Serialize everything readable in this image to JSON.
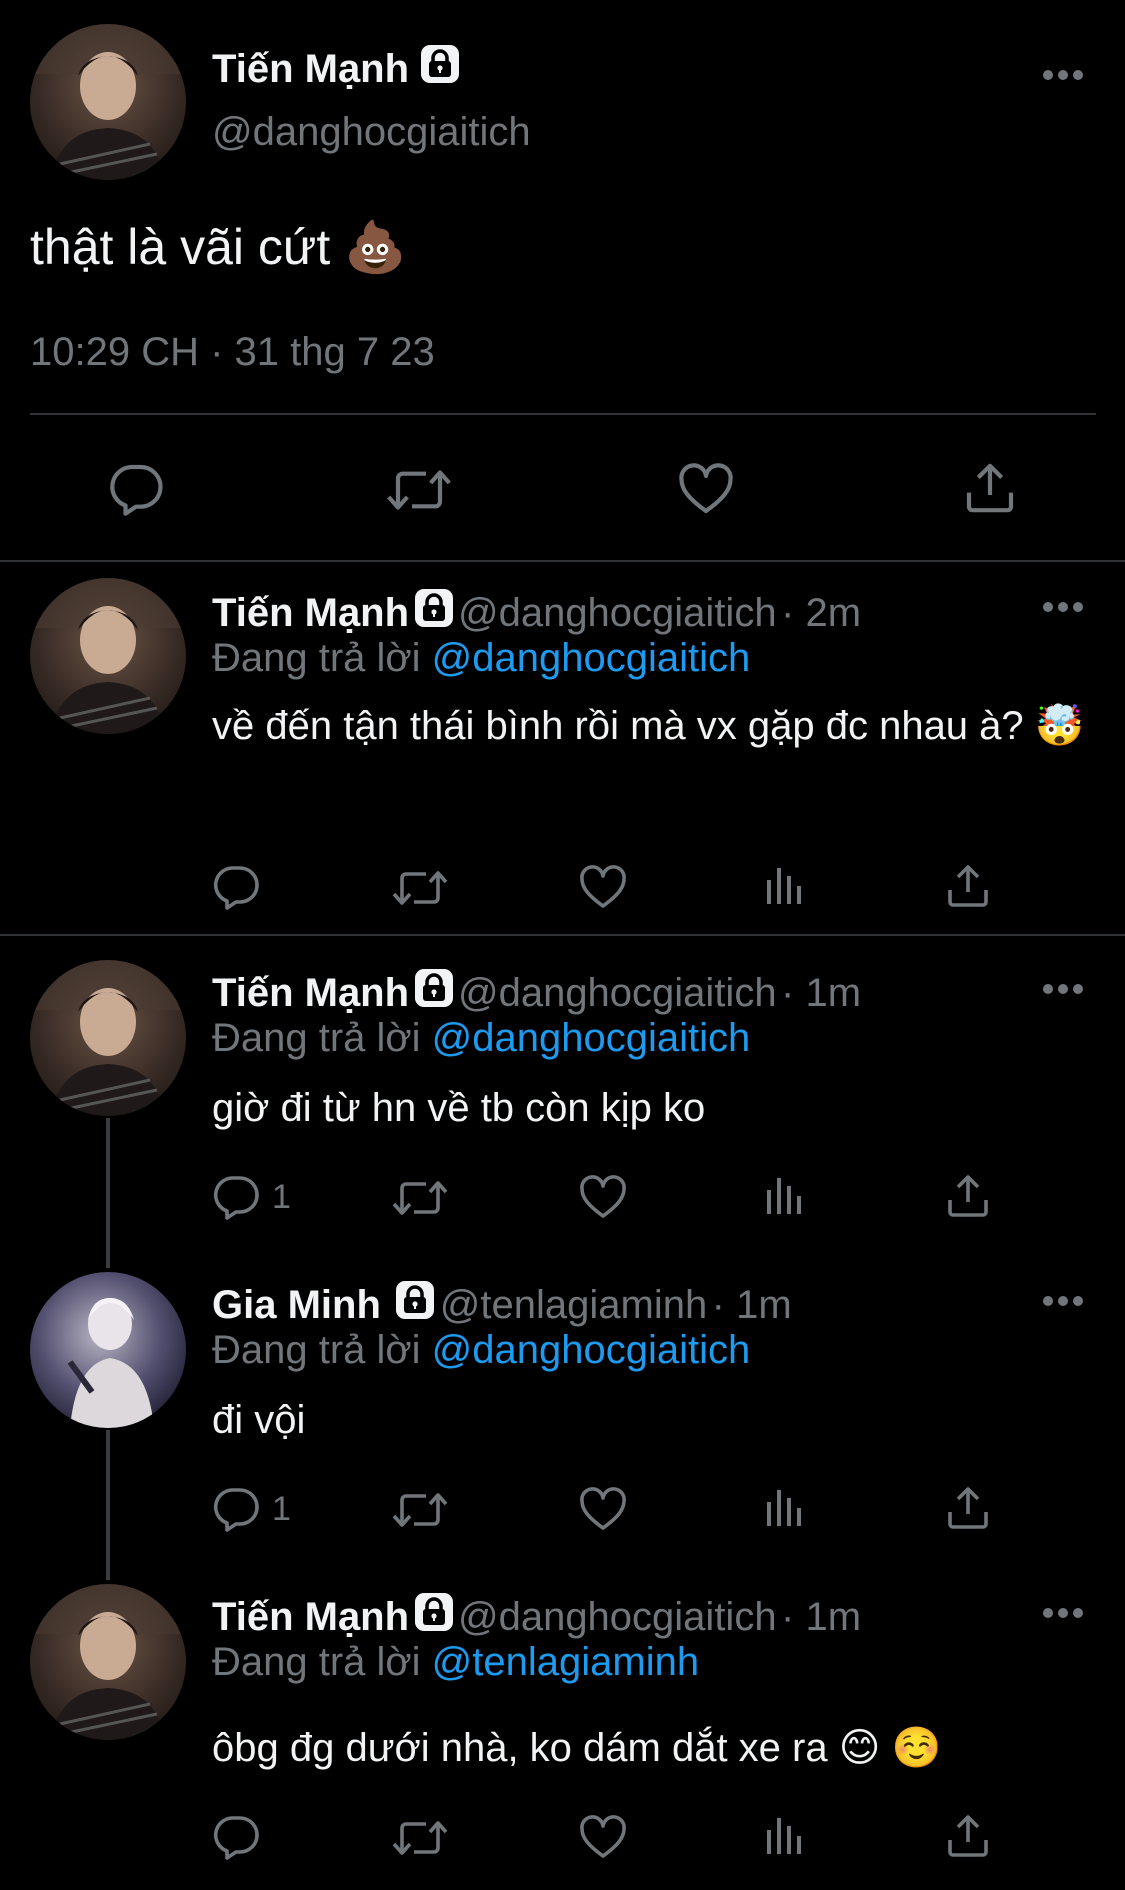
{
  "colors": {
    "background": "#000000",
    "text": "#f2f3f4",
    "muted": "#71767b",
    "link": "#1d9bf0",
    "divider": "#2f3336"
  },
  "main_tweet": {
    "name": "Tiến Mạnh",
    "handle": "@danghocgiaitich",
    "text": "thật là vãi cứt 💩",
    "timestamp": "10:29 CH · 31 thg 7 23",
    "actions": [
      "reply-icon",
      "retweet-icon",
      "like-icon",
      "share-icon"
    ]
  },
  "replies": [
    {
      "name": "Tiến Mạnh",
      "handle": "@danghocgiaitich",
      "time": "· 2m",
      "replying_prefix": "Đang trả lời",
      "replying_to": "@danghocgiaitich",
      "text": "về đến tận thái bình rồi mà vx gặp đc nhau à? 🤯",
      "reply_count": ""
    },
    {
      "name": "Tiến Mạnh",
      "handle": "@danghocgiaitich",
      "time": "· 1m",
      "replying_prefix": "Đang trả lời",
      "replying_to": "@danghocgiaitich",
      "text": "giờ đi từ hn về tb còn kịp ko",
      "reply_count": "1"
    },
    {
      "name": "Gia Minh",
      "handle": "@tenlagiaminh",
      "time": "· 1m",
      "replying_prefix": "Đang trả lời",
      "replying_to": "@danghocgiaitich",
      "text": "đi vội",
      "reply_count": "1"
    },
    {
      "name": "Tiến Mạnh",
      "handle": "@danghocgiaitich",
      "time": "· 1m",
      "replying_prefix": "Đang trả lời",
      "replying_to": "@tenlagiaminh",
      "text": "ôbg đg dưới nhà, ko dám dắt xe ra 😊 ☺️",
      "reply_count": ""
    }
  ]
}
